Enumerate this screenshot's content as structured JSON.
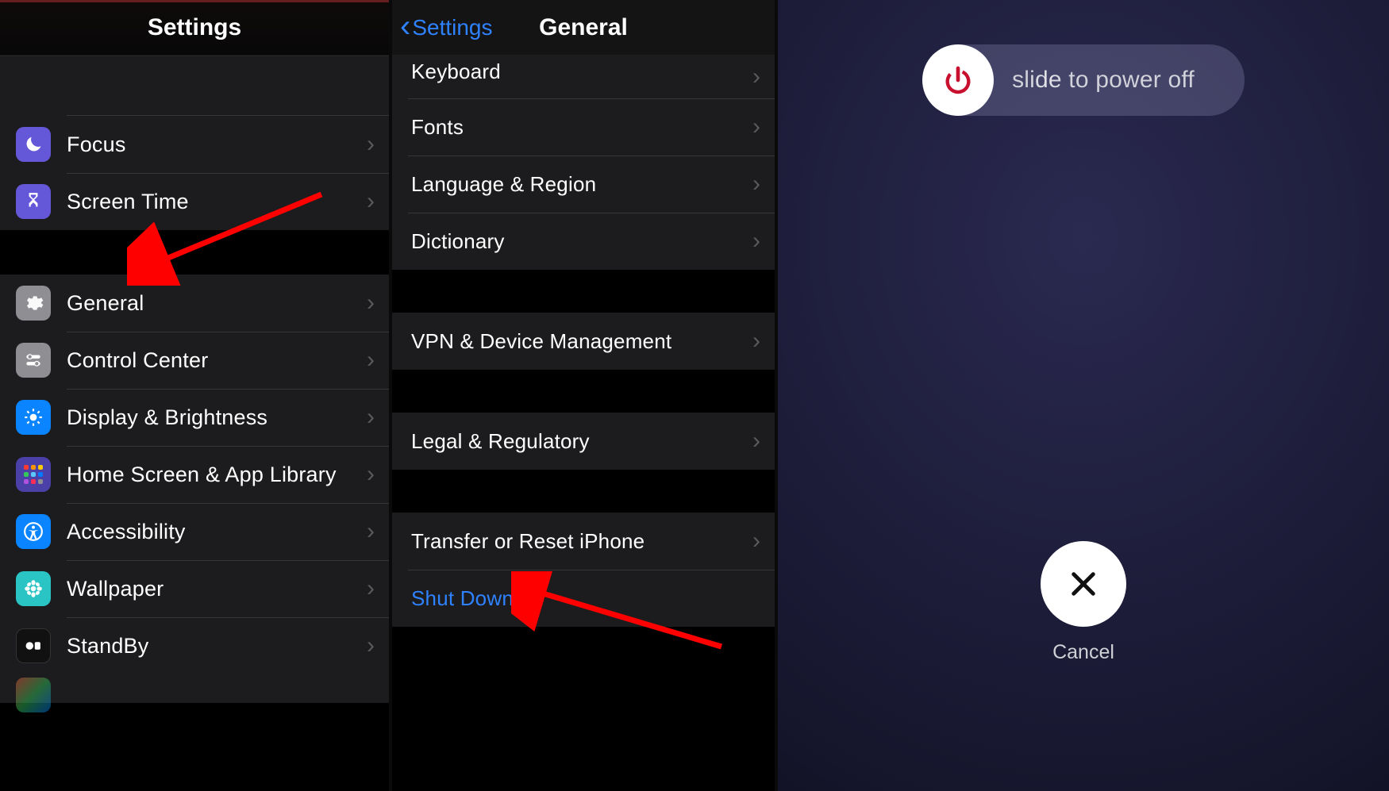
{
  "panel1": {
    "title": "Settings",
    "rows_group1": [
      {
        "id": "focus",
        "label": "Focus"
      },
      {
        "id": "screen-time",
        "label": "Screen Time"
      }
    ],
    "rows_group2": [
      {
        "id": "general",
        "label": "General"
      },
      {
        "id": "control-center",
        "label": "Control Center"
      },
      {
        "id": "display",
        "label": "Display & Brightness"
      },
      {
        "id": "home",
        "label": "Home Screen & App Library"
      },
      {
        "id": "accessibility",
        "label": "Accessibility"
      },
      {
        "id": "wallpaper",
        "label": "Wallpaper"
      },
      {
        "id": "standby",
        "label": "StandBy"
      }
    ]
  },
  "panel2": {
    "back_label": "Settings",
    "title": "General",
    "group_a": [
      {
        "id": "keyboard",
        "label": "Keyboard"
      },
      {
        "id": "fonts",
        "label": "Fonts"
      },
      {
        "id": "language-region",
        "label": "Language & Region"
      },
      {
        "id": "dictionary",
        "label": "Dictionary"
      }
    ],
    "group_b": [
      {
        "id": "vpn",
        "label": "VPN & Device Management"
      }
    ],
    "group_c": [
      {
        "id": "legal",
        "label": "Legal & Regulatory"
      }
    ],
    "group_d": [
      {
        "id": "transfer",
        "label": "Transfer or Reset iPhone",
        "has_chev": true
      },
      {
        "id": "shutdown",
        "label": "Shut Down",
        "has_chev": false,
        "blue": true
      }
    ]
  },
  "panel3": {
    "slide_text": "slide to power off",
    "cancel_label": "Cancel"
  },
  "colors": {
    "ios_blue": "#2f82ff",
    "arrow_red": "#ff0000",
    "power_red": "#c8102e"
  }
}
